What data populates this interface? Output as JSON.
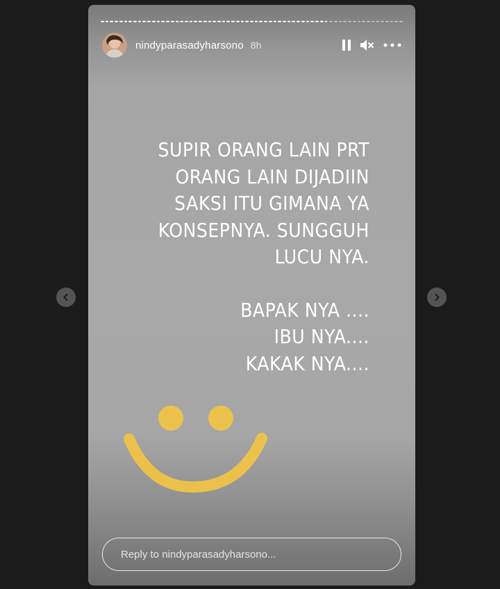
{
  "story": {
    "username": "nindyparasadyharsono",
    "time_ago": "8h",
    "progress_segments": [
      "done",
      "done",
      "done",
      "done",
      "done",
      "done",
      "done",
      "done",
      "done",
      "done",
      "done",
      "done",
      "done",
      "done",
      "done",
      "done",
      "done",
      "done",
      "done",
      "done",
      "done",
      "done",
      "done",
      "done",
      "done",
      "done",
      "done",
      "done",
      "done",
      "done",
      "done",
      "done",
      "done",
      "done",
      "done",
      "done",
      "done",
      "done",
      "done",
      "done",
      "done",
      "done",
      "done",
      "done",
      "done",
      "done",
      "done",
      "done",
      "active",
      "todo",
      "todo",
      "todo",
      "todo",
      "todo",
      "todo",
      "todo",
      "todo",
      "todo",
      "todo",
      "todo",
      "todo",
      "todo",
      "todo",
      "todo",
      "todo"
    ],
    "text_lines": [
      "SUPIR ORANG LAIN PRT",
      "ORANG LAIN DIJADIIN",
      "SAKSI ITU GIMANA YA",
      "KONSEPNYA. SUNGGUH",
      "LUCU NYA.",
      "",
      "BAPAK NYA ....",
      "IBU NYA....",
      "KAKAK NYA...."
    ],
    "smiley_color": "#f5c542",
    "reply_placeholder": "Reply to nindyparasadyharsono..."
  },
  "icons": {
    "pause": "pause-icon",
    "mute": "speaker-muted-icon",
    "more": "more-horizontal-icon",
    "prev": "chevron-left-icon",
    "next": "chevron-right-icon"
  }
}
